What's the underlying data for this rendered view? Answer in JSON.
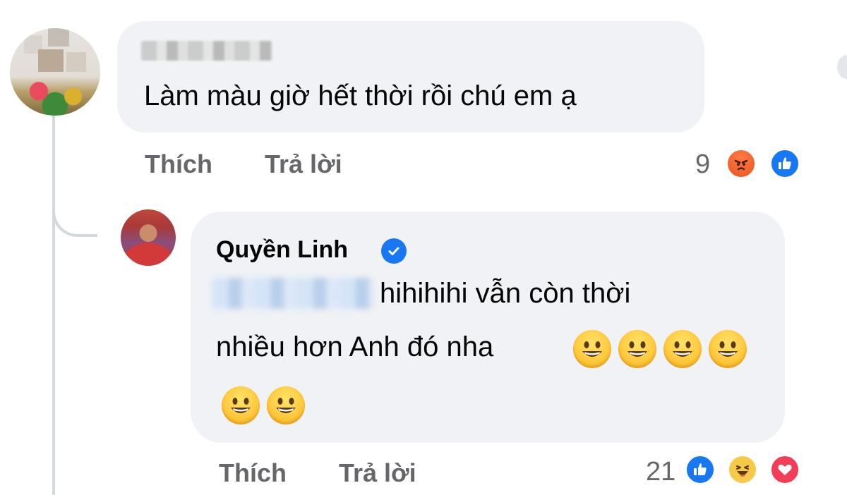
{
  "comment": {
    "author_name": "",
    "text": "Làm màu giờ hết thời rồi chú em ạ",
    "actions": {
      "like_label": "Thích",
      "reply_label": "Trả lời"
    },
    "reaction_count": "9",
    "reactions": [
      "angry-reaction-icon",
      "like-reaction-icon"
    ]
  },
  "reply": {
    "author_name": "Quyền Linh",
    "verified": true,
    "mention": "",
    "text_line1": "hihihihi vẫn còn thời",
    "text_line2": "nhiều hơn Anh đó nha",
    "emoji_count": 6,
    "emoji_icon": "grinning-face-emoji",
    "actions": {
      "like_label": "Thích",
      "reply_label": "Trả lời"
    },
    "reaction_count": "21",
    "reactions": [
      "like-reaction-icon",
      "haha-reaction-icon",
      "love-reaction-icon"
    ]
  },
  "colors": {
    "bubble_bg": "#f0f2f5",
    "action_text": "#65676b",
    "facebook_blue": "#1877f2",
    "angry_orange": "#e8541d",
    "love_red": "#f33e58"
  }
}
